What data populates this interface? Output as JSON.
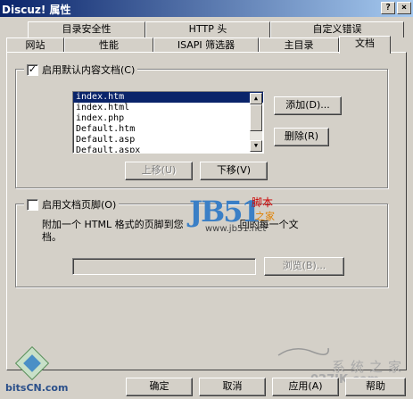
{
  "window": {
    "title": "Discuz! 属性",
    "help_glyph": "?",
    "close_glyph": "×"
  },
  "tabs_row1": [
    "目录安全性",
    "HTTP 头",
    "自定义错误"
  ],
  "tabs_row2": [
    "网站",
    "性能",
    "ISAPI 筛选器",
    "主目录",
    "文档"
  ],
  "default_doc": {
    "label": "启用默认内容文档(C)",
    "checked": true,
    "check_glyph": "✓",
    "files": [
      "index.htm",
      "index.html",
      "index.php",
      "Default.htm",
      "Default.asp",
      "Default.aspx"
    ],
    "add": "添加(D)...",
    "remove": "删除(R)",
    "move_up": "上移(U)",
    "move_down": "下移(V)"
  },
  "footer_doc": {
    "label": "启用文档页脚(O)",
    "checked": false,
    "description_line1": "附加一个 HTML 格式的页脚到您",
    "description_line1_end": "回的每一个文",
    "description_line2": "档。",
    "browse": "浏览(B)..."
  },
  "watermarks": {
    "jb51_logo": "JB51",
    "jb51_cn_text": "脚本",
    "jb51_sub": "之家",
    "jb51_url": "www.jb51.net",
    "bitscn": "bitsCN.com",
    "xitong": "系统之家",
    "url2": "027JK.com"
  },
  "buttons": {
    "ok": "确定",
    "cancel": "取消",
    "apply": "应用(A)",
    "help": "帮助"
  }
}
